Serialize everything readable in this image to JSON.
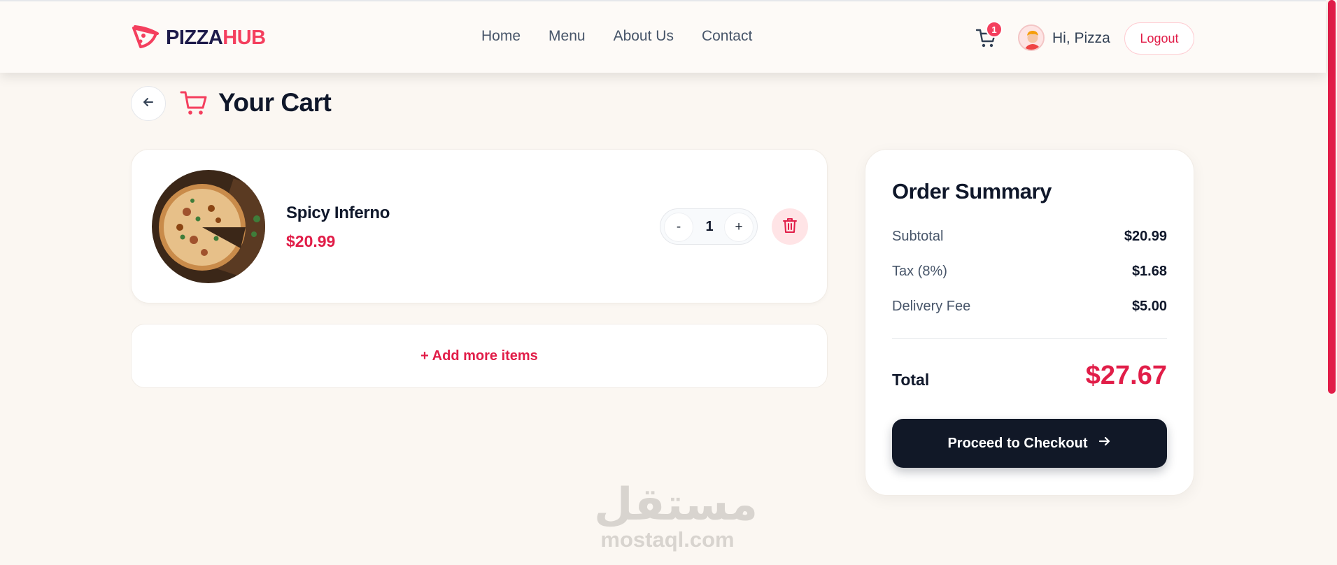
{
  "brand": {
    "part1": "PIZZA",
    "part2": "HUB",
    "accent": "#f43f5e",
    "dark": "#1e1b4b"
  },
  "nav": {
    "links": [
      "Home",
      "Menu",
      "About Us",
      "Contact"
    ]
  },
  "header": {
    "cart_count": "1",
    "greeting": "Hi, Pizza",
    "logout_label": "Logout"
  },
  "page": {
    "title": "Your Cart"
  },
  "cart_items": [
    {
      "name": "Spicy Inferno",
      "price": "$20.99",
      "quantity": "1",
      "minus_label": "-",
      "plus_label": "+"
    }
  ],
  "add_more_label": "+ Add more items",
  "summary": {
    "title": "Order Summary",
    "rows": [
      {
        "label": "Subtotal",
        "value": "$20.99"
      },
      {
        "label": "Tax (8%)",
        "value": "$1.68"
      },
      {
        "label": "Delivery Fee",
        "value": "$5.00"
      }
    ],
    "total_label": "Total",
    "total_value": "$27.67",
    "checkout_label": "Proceed to Checkout"
  },
  "watermark": {
    "arabic": "مستقل",
    "latin": "mostaql.com"
  },
  "icons": [
    "pizza-logo-icon",
    "cart-icon",
    "user-avatar-icon",
    "arrow-left-icon",
    "trash-icon",
    "arrow-right-icon"
  ],
  "colors": {
    "background": "#fbf7f2",
    "accent": "#e11d48",
    "button_dark": "#111827"
  }
}
